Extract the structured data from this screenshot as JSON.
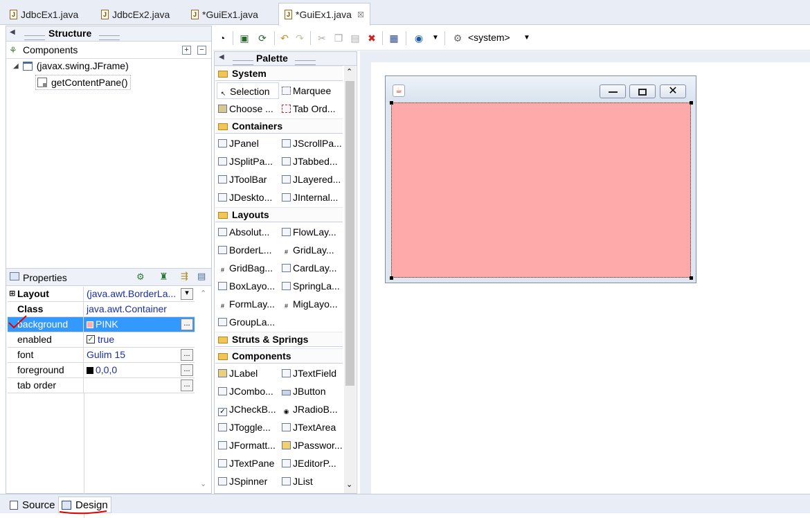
{
  "editor_tabs": [
    {
      "label": "JdbcEx1.java",
      "active": false
    },
    {
      "label": "JdbcEx2.java",
      "active": false
    },
    {
      "label": "*GuiEx1.java",
      "active": false
    },
    {
      "label": "*GuiEx1.java",
      "active": true,
      "close": "☒"
    }
  ],
  "structure": {
    "title": "Structure",
    "components_title": "Components",
    "tree": [
      {
        "label": "(javax.swing.JFrame)",
        "level": 0
      },
      {
        "label": "getContentPane()",
        "level": 1
      }
    ]
  },
  "properties": {
    "title": "Properties",
    "rows": [
      {
        "key": "Layout",
        "value": "(java.awt.BorderLa...",
        "bold": true,
        "expand": "⊞",
        "button": "▾"
      },
      {
        "key": "Class",
        "value": "java.awt.Container",
        "bold": true
      },
      {
        "key": "background",
        "value": "PINK",
        "selected": true,
        "swatch": "#ffafaf",
        "button": "..."
      },
      {
        "key": "enabled",
        "value": "true",
        "checkbox": true
      },
      {
        "key": "font",
        "value": "Gulim 15",
        "button": "..."
      },
      {
        "key": "foreground",
        "value": "0,0,0",
        "swatch": "#000000",
        "button": "..."
      },
      {
        "key": "tab order",
        "value": "",
        "button": "..."
      }
    ]
  },
  "toolbar": {
    "system_label": "<system>"
  },
  "palette": {
    "title": "Palette",
    "categories": [
      {
        "name": "System",
        "items": [
          "Selection",
          "Marquee",
          "Choose ...",
          "Tab Ord..."
        ]
      },
      {
        "name": "Containers",
        "items": [
          "JPanel",
          "JScrollPa...",
          "JSplitPa...",
          "JTabbed...",
          "JToolBar",
          "JLayered...",
          "JDeskto...",
          "JInternal..."
        ]
      },
      {
        "name": "Layouts",
        "items": [
          "Absolut...",
          "FlowLay...",
          "BorderL...",
          "GridLay...",
          "GridBag...",
          "CardLay...",
          "BoxLayo...",
          "SpringLa...",
          "FormLay...",
          "MigLayo...",
          "GroupLa..."
        ]
      },
      {
        "name": "Struts & Springs",
        "items": []
      },
      {
        "name": "Components",
        "items": [
          "JLabel",
          "JTextField",
          "JCombo...",
          "JButton",
          "JCheckB...",
          "JRadioB...",
          "JToggle...",
          "JTextArea",
          "JFormatt...",
          "JPasswor...",
          "JTextPane",
          "JEditorP...",
          "JSpinner",
          "JList"
        ]
      }
    ]
  },
  "design_canvas": {
    "content_background": "#ffaaaa"
  },
  "bottom_tabs": [
    {
      "label": "Source",
      "active": false
    },
    {
      "label": "Design",
      "active": true
    }
  ]
}
